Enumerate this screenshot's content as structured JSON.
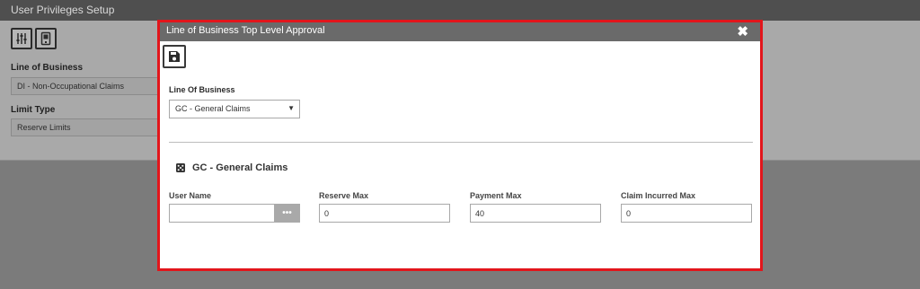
{
  "background": {
    "title": "User Privileges Setup",
    "icons": [
      "sliders-icon",
      "mobile-device-icon"
    ],
    "line_of_business_label": "Line of Business",
    "line_of_business_value": "DI - Non-Occupational Claims",
    "limit_type_label": "Limit Type",
    "limit_type_value": "Reserve Limits"
  },
  "modal": {
    "title": "Line of Business Top Level Approval",
    "close_glyph": "✖",
    "save_icon": "save-icon",
    "lob_label": "Line Of Business",
    "lob_selected": "GC - General Claims",
    "dropdown_glyph": "▼",
    "section_title": "GC - General Claims",
    "user_name_label": "User Name",
    "user_name_value": "",
    "lookup_glyph": "•••",
    "reserve_max_label": "Reserve Max",
    "reserve_max_value": "0",
    "payment_max_label": "Payment Max",
    "payment_max_value": "40",
    "claim_incurred_max_label": "Claim Incurred Max",
    "claim_incurred_max_value": "0"
  },
  "colors": {
    "highlight_border": "#e2151b",
    "modal_header": "#6a6a6a"
  }
}
